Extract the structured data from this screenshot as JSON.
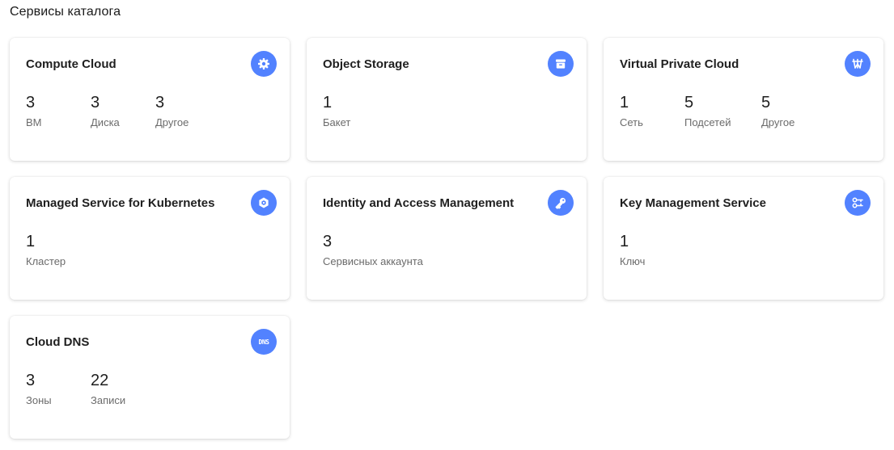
{
  "page": {
    "title": "Сервисы каталога"
  },
  "colors": {
    "icon_background": "#5282ff",
    "card_background": "#ffffff"
  },
  "cards": [
    {
      "title": "Compute Cloud",
      "icon": "gear-icon",
      "stats": [
        {
          "value": "3",
          "label": "ВМ"
        },
        {
          "value": "3",
          "label": "Диска"
        },
        {
          "value": "3",
          "label": "Другое"
        }
      ]
    },
    {
      "title": "Object Storage",
      "icon": "storage-box-icon",
      "stats": [
        {
          "value": "1",
          "label": "Бакет"
        }
      ]
    },
    {
      "title": "Virtual Private Cloud",
      "icon": "network-icon",
      "stats": [
        {
          "value": "1",
          "label": "Сеть"
        },
        {
          "value": "5",
          "label": "Подсетей"
        },
        {
          "value": "5",
          "label": "Другое"
        }
      ]
    },
    {
      "title": "Managed Service for Kubernetes",
      "icon": "kubernetes-hexagon-icon",
      "stats": [
        {
          "value": "1",
          "label": "Кластер"
        }
      ]
    },
    {
      "title": "Identity and Access Management",
      "icon": "key-icon",
      "stats": [
        {
          "value": "3",
          "label": "Сервисных аккаунта"
        }
      ]
    },
    {
      "title": "Key Management Service",
      "icon": "key-management-icon",
      "stats": [
        {
          "value": "1",
          "label": "Ключ"
        }
      ]
    },
    {
      "title": "Cloud DNS",
      "icon": "dns-icon",
      "icon_text": "DNS",
      "stats": [
        {
          "value": "3",
          "label": "Зоны"
        },
        {
          "value": "22",
          "label": "Записи"
        }
      ]
    }
  ]
}
